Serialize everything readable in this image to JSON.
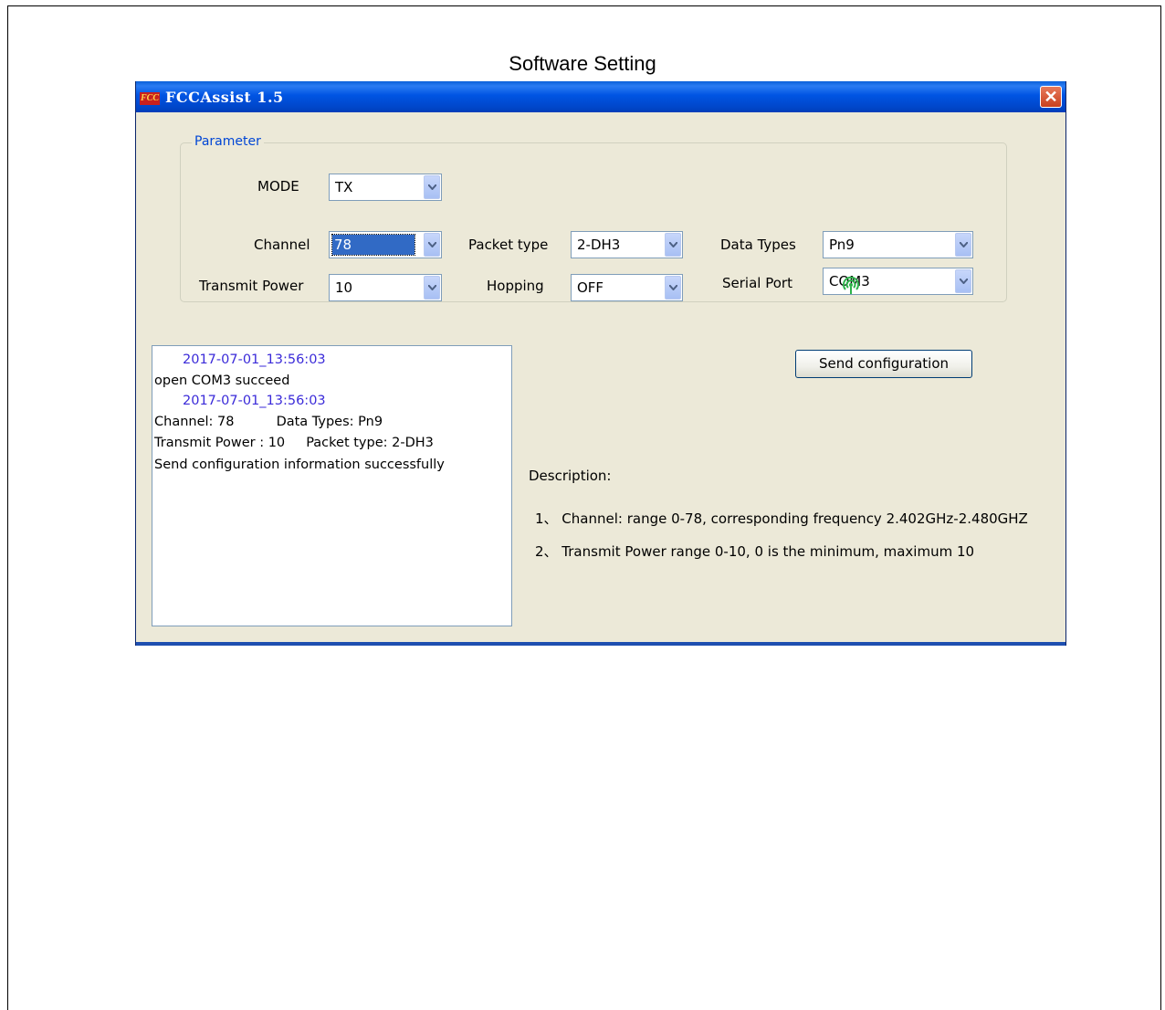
{
  "doc": {
    "title": "Software Setting"
  },
  "window": {
    "icon_text": "FCC",
    "title": "FCCAssist  1.5",
    "close_symbol": "✕"
  },
  "parameter": {
    "legend": "Parameter",
    "mode": {
      "label": "MODE",
      "value": "TX"
    },
    "channel": {
      "label": "Channel",
      "value": "78"
    },
    "packet_type": {
      "label": "Packet type",
      "value": "2-DH3"
    },
    "data_types": {
      "label": "Data Types",
      "value": "Pn9"
    },
    "transmit_power": {
      "label": "Transmit Power",
      "value": "10"
    },
    "hopping": {
      "label": "Hopping",
      "value": "OFF"
    },
    "serial_port": {
      "label": "Serial Port",
      "value": "COM3"
    }
  },
  "log": [
    {
      "kind": "time",
      "text": "2017-07-01_13:56:03"
    },
    {
      "kind": "msg",
      "text": "open COM3 succeed"
    },
    {
      "kind": "time",
      "text": "2017-07-01_13:56:03"
    },
    {
      "kind": "msg",
      "text": "Channel: 78          Data Types: Pn9"
    },
    {
      "kind": "msg",
      "text": "Transmit Power : 10     Packet type: 2-DH3"
    },
    {
      "kind": "msg",
      "text": "Send configuration information successfully"
    }
  ],
  "send_button": "Send configuration",
  "description": {
    "heading": "Description:",
    "items": [
      "1、 Channel: range 0-78, corresponding frequency 2.402GHz-2.480GHZ",
      "2、 Transmit Power  range 0-10, 0 is the minimum, maximum 10"
    ]
  },
  "colors": {
    "titlebar": "#0054E3",
    "window_bg": "#ECE9D8",
    "accent": "#316AC5",
    "log_time": "#3B2BD9",
    "signal": "#2DB34A"
  },
  "icons": {
    "app": "fcc-app-icon",
    "close": "close-icon",
    "dropdown": "chevron-down-icon",
    "signal": "wireless-signal-icon"
  }
}
